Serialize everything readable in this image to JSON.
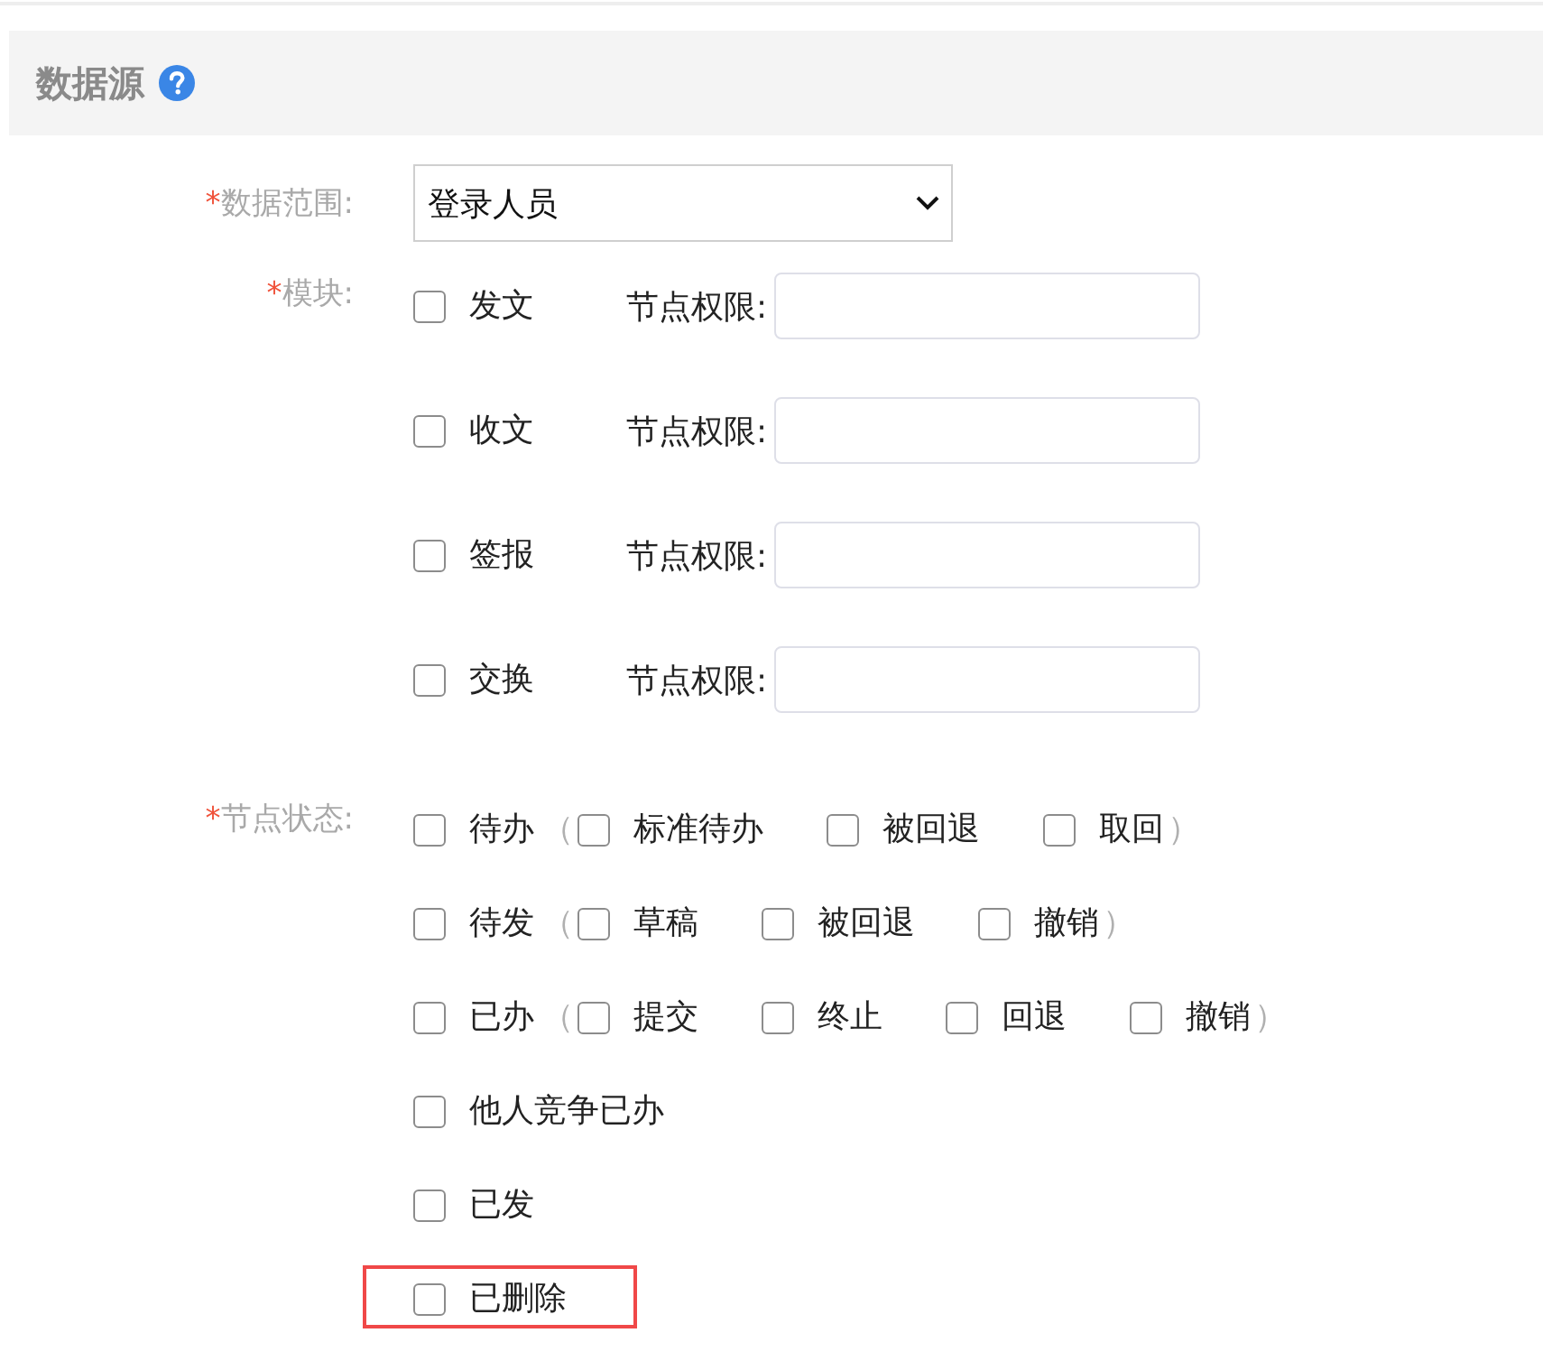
{
  "header": {
    "title": "数据源"
  },
  "fields": [
    {
      "kind": "select",
      "required_mark": "*",
      "label": "数据范围:",
      "value": "登录人员"
    },
    {
      "kind": "modules",
      "required_mark": "*",
      "label": "模块:",
      "rows": [
        {
          "label": "发文",
          "checked": false,
          "permission_label": "节点权限:"
        },
        {
          "label": "收文",
          "checked": false,
          "permission_label": "节点权限:"
        },
        {
          "label": "签报",
          "checked": false,
          "permission_label": "节点权限:"
        },
        {
          "label": "交换",
          "checked": false,
          "permission_label": "节点权限:"
        }
      ]
    },
    {
      "kind": "status",
      "required_mark": "*",
      "label": "节点状态:",
      "rows": [
        {
          "label": "待办",
          "checked": false,
          "highlighted": false,
          "open_paren": "（",
          "close_paren": "）",
          "children": [
            {
              "label": "标准待办",
              "checked": false
            },
            {
              "label": "被回退",
              "checked": false
            },
            {
              "label": "取回",
              "checked": false
            }
          ]
        },
        {
          "label": "待发",
          "checked": false,
          "highlighted": false,
          "open_paren": "（",
          "close_paren": "）",
          "children": [
            {
              "label": "草稿",
              "checked": false
            },
            {
              "label": "被回退",
              "checked": false
            },
            {
              "label": "撤销",
              "checked": false
            }
          ]
        },
        {
          "label": "已办",
          "checked": false,
          "highlighted": false,
          "open_paren": "（",
          "close_paren": "）",
          "children": [
            {
              "label": "提交",
              "checked": false
            },
            {
              "label": "终止",
              "checked": false
            },
            {
              "label": "回退",
              "checked": false
            },
            {
              "label": "撤销",
              "checked": false
            }
          ]
        },
        {
          "label": "他人竞争已办",
          "checked": false,
          "highlighted": false
        },
        {
          "label": "已发",
          "checked": false,
          "highlighted": false
        },
        {
          "label": "已删除",
          "checked": false,
          "highlighted": true
        }
      ]
    }
  ]
}
